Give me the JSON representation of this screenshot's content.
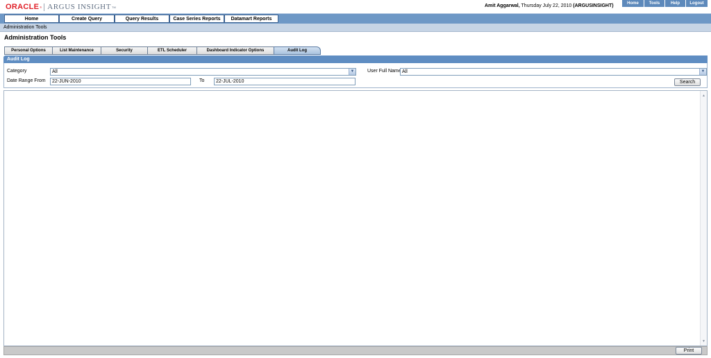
{
  "header": {
    "logo_brand": "ORACLE",
    "logo_reg": "®",
    "logo_product": "ARGUS INSIGHT",
    "logo_tm": "TM",
    "user_name": "Amit Aggarwal,",
    "user_date": "Thursday July 22, 2010",
    "user_db": "(ARGUSINSIGHT)",
    "top_links": [
      "Home",
      "Tools",
      "Help",
      "Logout"
    ]
  },
  "nav": {
    "buttons": [
      "Home",
      "Create Query",
      "Query Results",
      "Case Series Reports",
      "Datamart Reports"
    ]
  },
  "breadcrumb": "Administration Tools",
  "page_title": "Administration Tools",
  "tabs": {
    "items": [
      "Personal Options",
      "List Maintenance",
      "Security",
      "ETL Scheduler",
      "Dashboard Indicator Options",
      "Audit Log"
    ],
    "active": "Audit Log"
  },
  "panel": {
    "title": "Audit Log",
    "category_label": "Category",
    "category_value": "All",
    "user_full_name_label": "User Full Name",
    "user_full_name_value": "All",
    "date_from_label": "Date Range From",
    "date_from_value": "22-JUN-2010",
    "date_to_label": "To",
    "date_to_value": "22-JUL-2010",
    "search_label": "Search"
  },
  "footer": {
    "print_label": "Print"
  },
  "icons": {
    "dropdown": "chevron-down-icon",
    "scroll_up": "triangle-up-icon",
    "scroll_down": "triangle-down-icon"
  },
  "colors": {
    "nav_bg": "#6e98c6",
    "panel_header": "#5f8dc2",
    "top_link_bg": "#5d89bb",
    "oracle_red": "#e01f27"
  }
}
